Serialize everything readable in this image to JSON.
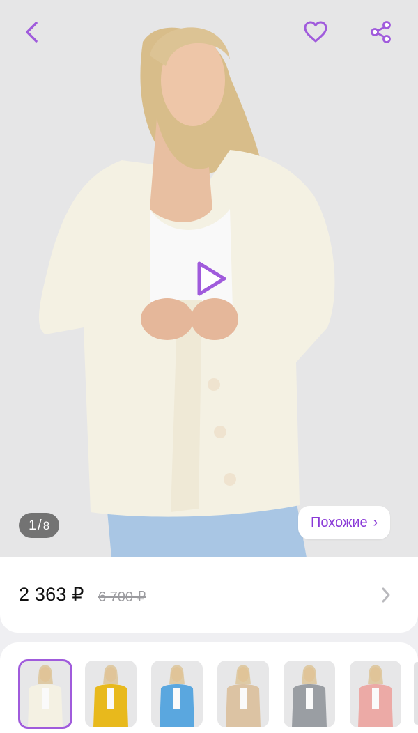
{
  "header": {
    "back_icon": "chevron-left-icon",
    "favorite_icon": "heart-icon",
    "share_icon": "share-icon"
  },
  "gallery": {
    "current": "1",
    "separator": "/",
    "total": "8",
    "play_icon": "play-icon",
    "similar_label": "Похожие",
    "similar_chevron": "›"
  },
  "price": {
    "current": "2 363 ₽",
    "old": "6 700 ₽",
    "chevron_icon": "chevron-right-icon"
  },
  "colors": {
    "swatches": [
      {
        "name": "cream",
        "hex": "#f4f1e3",
        "selected": true
      },
      {
        "name": "yellow",
        "hex": "#e8b91c"
      },
      {
        "name": "blue",
        "hex": "#5aa7df"
      },
      {
        "name": "beige",
        "hex": "#dcc3a3"
      },
      {
        "name": "gray",
        "hex": "#9a9ea3"
      },
      {
        "name": "pink",
        "hex": "#ecaaa6"
      }
    ]
  },
  "theme": {
    "accent": "#8a3ad7",
    "icon_purple": "#a05bdc"
  }
}
